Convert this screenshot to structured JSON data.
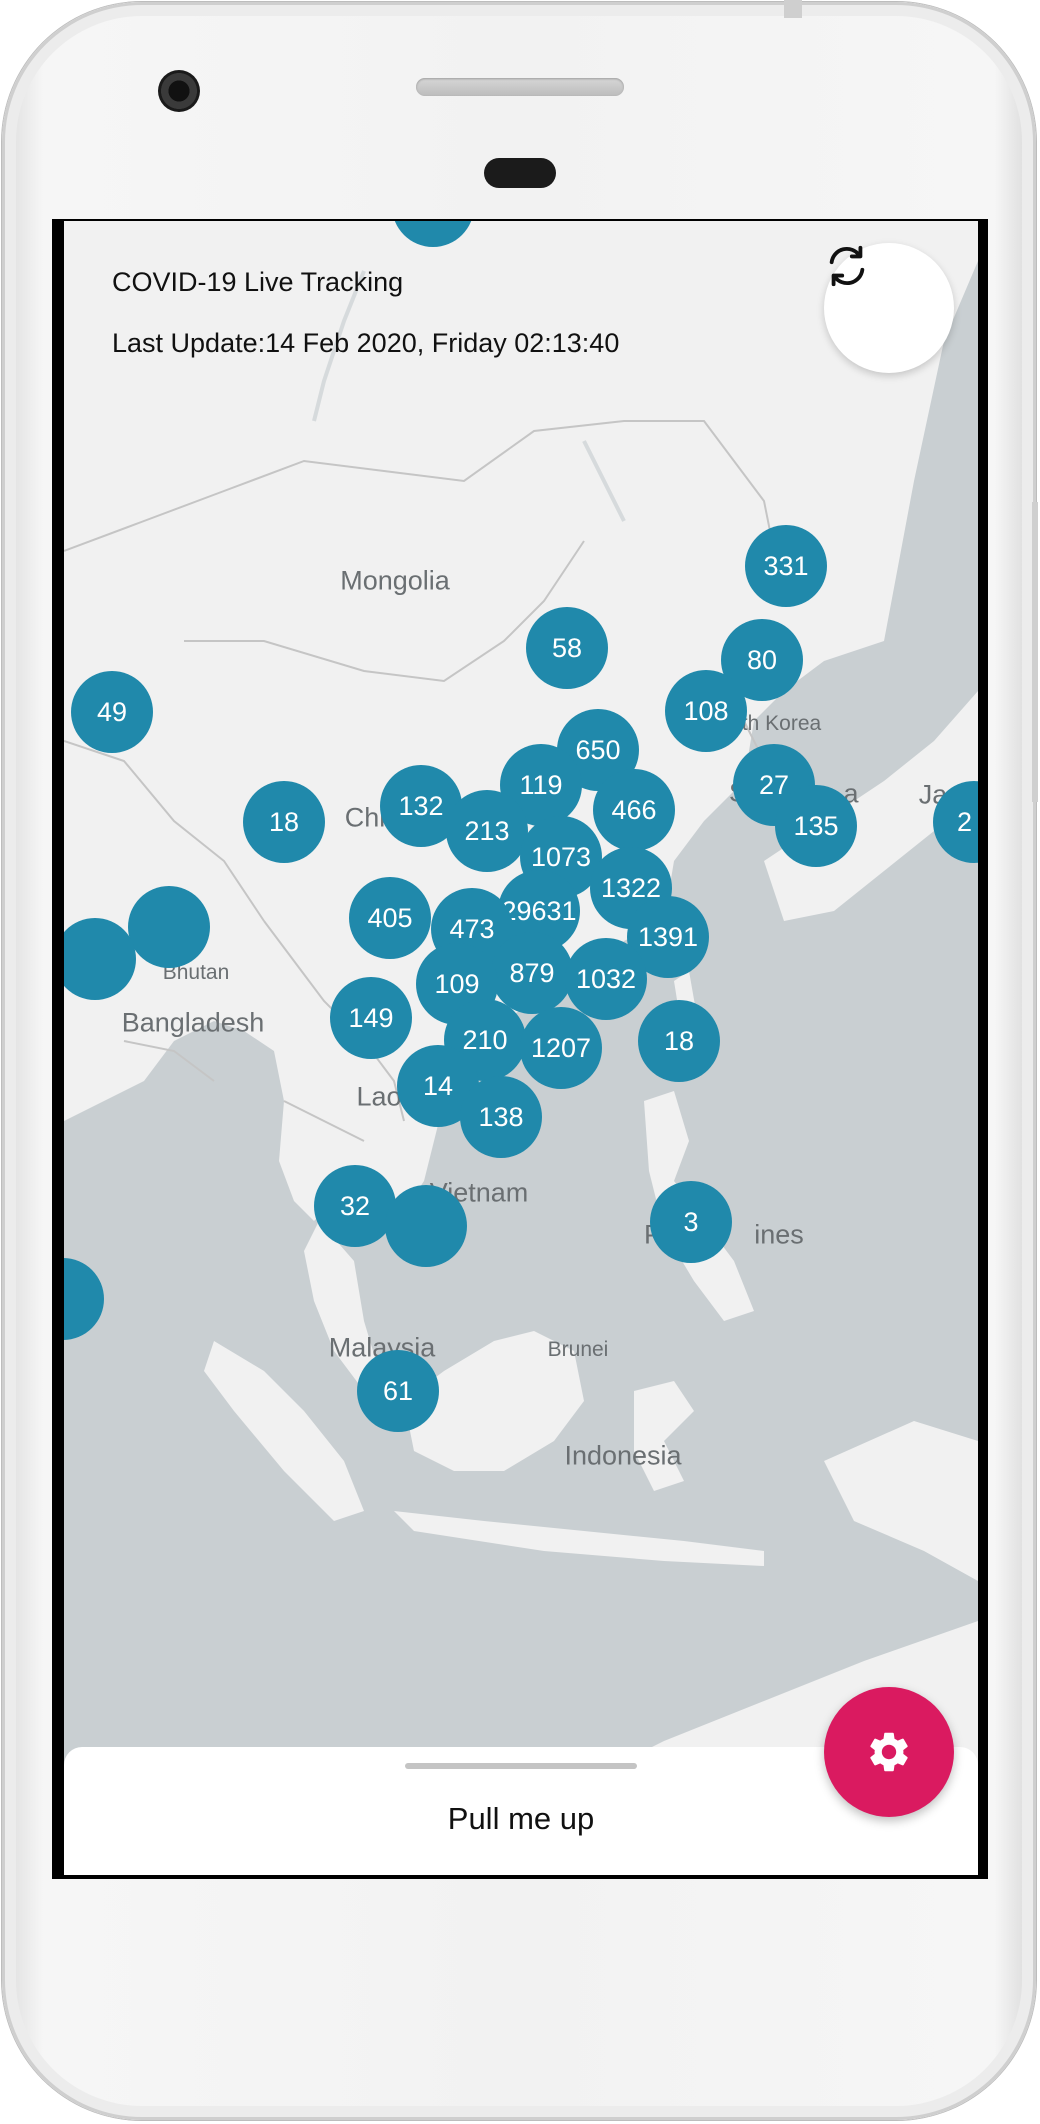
{
  "app": {
    "title": "COVID-19 Live Tracking",
    "last_update": "Last Update:14 Feb 2020, Friday 02:13:40"
  },
  "toolbar": {
    "refresh_icon": "refresh-icon",
    "settings_icon": "gear-icon"
  },
  "bottom_sheet": {
    "label": "Pull me up"
  },
  "colors": {
    "cluster": "#2089ab",
    "fab": "#da1a60",
    "water": "#c9cfd2",
    "land": "#f1f1f1"
  },
  "map_labels": {
    "mongolia": "Mongolia",
    "china": "Chi",
    "north_korea": "rth Korea",
    "japan": "Ja",
    "bhutan": "Bhutan",
    "bangladesh": "Bangladesh",
    "laos": "Lao",
    "vietnam": "Vietnam",
    "philippines": "ines",
    "philippines_p": "P",
    "sri_lanka": "ka",
    "malaysia": "Malaysia",
    "brunei": "Brunei",
    "indonesia": "Indonesia",
    "south_korea_s": "S",
    "south_korea_a": "a"
  },
  "clusters": {
    "c331": "331",
    "c58": "58",
    "c80": "80",
    "c49": "49",
    "c108": "108",
    "c650": "650",
    "c119": "119",
    "c27": "27",
    "c18a": "18",
    "c132": "132",
    "c213": "213",
    "c466": "466",
    "c135": "135",
    "c2": "2",
    "c1073": "1073",
    "c1322": "1322",
    "c405": "405",
    "c29631": "29631",
    "c473": "473",
    "c1391": "1391",
    "c879": "879",
    "c1032": "1032",
    "c109": "109",
    "c149": "149",
    "c210": "210",
    "c1207": "1207",
    "c18b": "18",
    "c14": "14",
    "c138": "138",
    "c32": "32",
    "c3": "3",
    "c61": "61"
  }
}
